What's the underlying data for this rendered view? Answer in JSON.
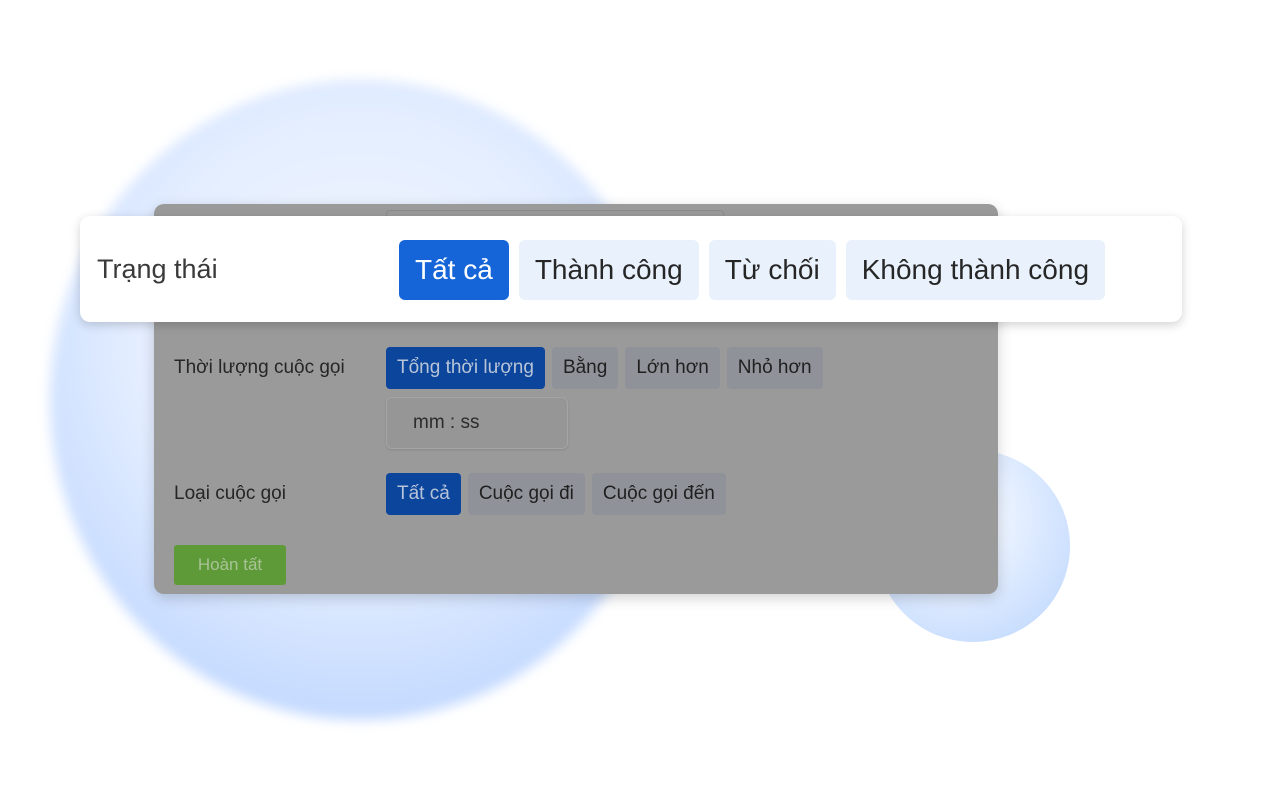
{
  "colors": {
    "accent": "#1565d8",
    "chip_bg": "#e9f2fc",
    "done_green": "#5f9a38",
    "overlay_gray": "#9a9a9a"
  },
  "status": {
    "label": "Trạng thái",
    "options": [
      {
        "label": "Tất cả",
        "active": true
      },
      {
        "label": "Thành công",
        "active": false
      },
      {
        "label": "Từ chối",
        "active": false
      },
      {
        "label": "Không thành công",
        "active": false
      }
    ]
  },
  "duration": {
    "label": "Thời lượng cuộc gọi",
    "options": [
      {
        "label": "Tổng thời lượng",
        "active": true
      },
      {
        "label": "Bằng",
        "active": false
      },
      {
        "label": "Lớn hơn",
        "active": false
      },
      {
        "label": "Nhỏ hơn",
        "active": false
      }
    ],
    "time_placeholder": "mm  :  ss"
  },
  "call_type": {
    "label": "Loại cuộc gọi",
    "options": [
      {
        "label": "Tất cả",
        "active": true
      },
      {
        "label": "Cuộc gọi đi",
        "active": false
      },
      {
        "label": "Cuộc gọi đến",
        "active": false
      }
    ]
  },
  "done_button": "Hoàn tất"
}
